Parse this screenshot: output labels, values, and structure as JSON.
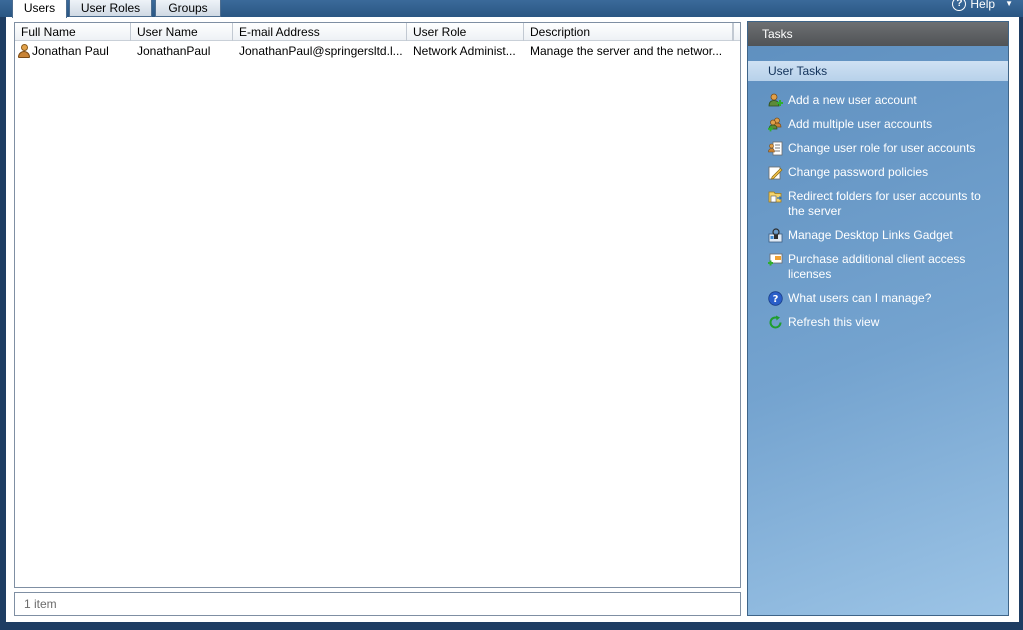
{
  "tabs": [
    {
      "label": "Users",
      "active": true
    },
    {
      "label": "User Roles",
      "active": false
    },
    {
      "label": "Groups",
      "active": false
    }
  ],
  "help": {
    "label": "Help",
    "icon": "help-circle-icon"
  },
  "table": {
    "columns": [
      "Full Name",
      "User Name",
      "E-mail Address",
      "User Role",
      "Description"
    ],
    "rows": [
      {
        "full_name": "Jonathan Paul",
        "user_name": "JonathanPaul",
        "email": "JonathanPaul@springersltd.l...",
        "role": "Network Administ...",
        "description": "Manage the server and the networ...",
        "icon": "user-icon"
      }
    ]
  },
  "status": {
    "text": "1 item"
  },
  "tasks_pane": {
    "title": "Tasks",
    "section_title": "User Tasks",
    "items": [
      {
        "label": "Add a new user account",
        "icon": "add-user-icon"
      },
      {
        "label": "Add multiple user accounts",
        "icon": "add-multiple-users-icon"
      },
      {
        "label": "Change user role for user accounts",
        "icon": "change-role-icon"
      },
      {
        "label": "Change password policies",
        "icon": "password-policy-icon"
      },
      {
        "label": "Redirect folders for user accounts to the server",
        "icon": "redirect-folders-icon"
      },
      {
        "label": "Manage Desktop Links Gadget",
        "icon": "desktop-links-gadget-icon"
      },
      {
        "label": "Purchase additional client access licenses",
        "icon": "purchase-licenses-icon"
      },
      {
        "label": "What users can I manage?",
        "icon": "question-icon"
      },
      {
        "label": "Refresh this view",
        "icon": "refresh-icon"
      }
    ]
  },
  "colors": {
    "tasks_pane_blue": "#74a3cf",
    "window_frame": "#1e3d63",
    "task_link_text": "#ffffff"
  }
}
